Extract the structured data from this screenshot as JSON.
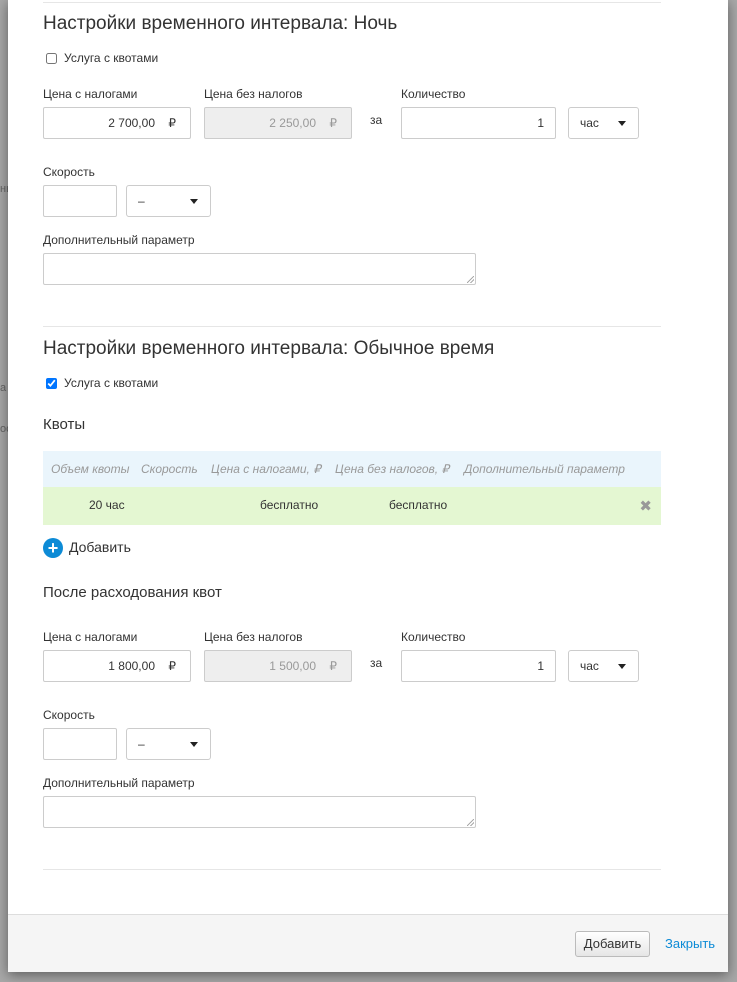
{
  "background": {
    "fragments": [
      "нь",
      "а",
      "ос"
    ]
  },
  "night": {
    "title": "Настройки временного интервала: Ночь",
    "quota_label": "Услуга с квотами",
    "quota_checked": false,
    "price_tax_label": "Цена с налогами",
    "price_tax_value": "2 700,00",
    "price_notax_label": "Цена без налогов",
    "price_notax_value": "2 250,00",
    "currency": "₽",
    "per_label": "за",
    "quantity_label": "Количество",
    "quantity_value": "1",
    "unit_value": "час",
    "speed_label": "Скорость",
    "speed_value": "",
    "speed_unit_value": "–",
    "extra_label": "Дополнительный параметр",
    "extra_value": ""
  },
  "normal": {
    "title": "Настройки временного интервала: Обычное время",
    "quota_label": "Услуга с квотами",
    "quota_checked": true,
    "quotas_title": "Квоты",
    "quota_table": {
      "headers": [
        "Объем квоты",
        "Скорость",
        "Цена с налогами, ₽",
        "Цена без налогов, ₽",
        "Дополнительный параметр"
      ],
      "rows": [
        {
          "volume": "20 час",
          "speed": "",
          "price_tax": "бесплатно",
          "price_notax": "бесплатно",
          "extra": ""
        }
      ],
      "delete_icon": "✖"
    },
    "add_label": "Добавить",
    "after_title": "После расходования квот",
    "price_tax_label": "Цена с налогами",
    "price_tax_value": "1 800,00",
    "price_notax_label": "Цена без налогов",
    "price_notax_value": "1 500,00",
    "currency": "₽",
    "per_label": "за",
    "quantity_label": "Количество",
    "quantity_value": "1",
    "unit_value": "час",
    "speed_label": "Скорость",
    "speed_value": "",
    "speed_unit_value": "–",
    "extra_label": "Дополнительный параметр",
    "extra_value": ""
  },
  "footer": {
    "add_button": "Добавить",
    "close_link": "Закрыть"
  },
  "colors": {
    "accent": "#0d8bd6",
    "table_header_bg": "#eaf5fc",
    "table_row_bg": "#e4f7d2"
  }
}
